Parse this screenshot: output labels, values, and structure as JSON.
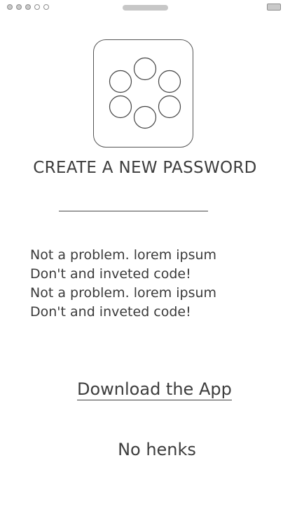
{
  "status_bar": {
    "signal_dots": [
      true,
      true,
      true,
      false,
      false
    ]
  },
  "app_icon": {
    "icon": "dots-ring-icon"
  },
  "title": "CREATE A NEW PASSWORD",
  "password_field": {
    "value": "",
    "placeholder": ""
  },
  "body_lines": [
    "Not a problem. lorem ipsum",
    "Don't and inveted code!",
    "Not a problem. lorem ipsum",
    "Don't and inveted code!"
  ],
  "download_link": "Download the App",
  "no_thanks": "No henks"
}
